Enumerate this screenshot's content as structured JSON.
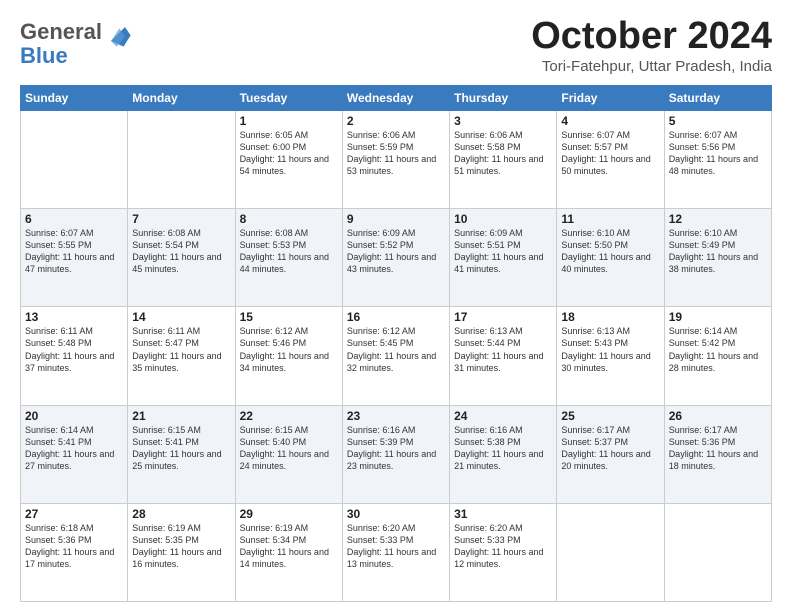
{
  "header": {
    "logo_general": "General",
    "logo_blue": "Blue",
    "month": "October 2024",
    "location": "Tori-Fatehpur, Uttar Pradesh, India"
  },
  "weekdays": [
    "Sunday",
    "Monday",
    "Tuesday",
    "Wednesday",
    "Thursday",
    "Friday",
    "Saturday"
  ],
  "weeks": [
    [
      {
        "day": "",
        "info": ""
      },
      {
        "day": "",
        "info": ""
      },
      {
        "day": "1",
        "info": "Sunrise: 6:05 AM\nSunset: 6:00 PM\nDaylight: 11 hours and 54 minutes."
      },
      {
        "day": "2",
        "info": "Sunrise: 6:06 AM\nSunset: 5:59 PM\nDaylight: 11 hours and 53 minutes."
      },
      {
        "day": "3",
        "info": "Sunrise: 6:06 AM\nSunset: 5:58 PM\nDaylight: 11 hours and 51 minutes."
      },
      {
        "day": "4",
        "info": "Sunrise: 6:07 AM\nSunset: 5:57 PM\nDaylight: 11 hours and 50 minutes."
      },
      {
        "day": "5",
        "info": "Sunrise: 6:07 AM\nSunset: 5:56 PM\nDaylight: 11 hours and 48 minutes."
      }
    ],
    [
      {
        "day": "6",
        "info": "Sunrise: 6:07 AM\nSunset: 5:55 PM\nDaylight: 11 hours and 47 minutes."
      },
      {
        "day": "7",
        "info": "Sunrise: 6:08 AM\nSunset: 5:54 PM\nDaylight: 11 hours and 45 minutes."
      },
      {
        "day": "8",
        "info": "Sunrise: 6:08 AM\nSunset: 5:53 PM\nDaylight: 11 hours and 44 minutes."
      },
      {
        "day": "9",
        "info": "Sunrise: 6:09 AM\nSunset: 5:52 PM\nDaylight: 11 hours and 43 minutes."
      },
      {
        "day": "10",
        "info": "Sunrise: 6:09 AM\nSunset: 5:51 PM\nDaylight: 11 hours and 41 minutes."
      },
      {
        "day": "11",
        "info": "Sunrise: 6:10 AM\nSunset: 5:50 PM\nDaylight: 11 hours and 40 minutes."
      },
      {
        "day": "12",
        "info": "Sunrise: 6:10 AM\nSunset: 5:49 PM\nDaylight: 11 hours and 38 minutes."
      }
    ],
    [
      {
        "day": "13",
        "info": "Sunrise: 6:11 AM\nSunset: 5:48 PM\nDaylight: 11 hours and 37 minutes."
      },
      {
        "day": "14",
        "info": "Sunrise: 6:11 AM\nSunset: 5:47 PM\nDaylight: 11 hours and 35 minutes."
      },
      {
        "day": "15",
        "info": "Sunrise: 6:12 AM\nSunset: 5:46 PM\nDaylight: 11 hours and 34 minutes."
      },
      {
        "day": "16",
        "info": "Sunrise: 6:12 AM\nSunset: 5:45 PM\nDaylight: 11 hours and 32 minutes."
      },
      {
        "day": "17",
        "info": "Sunrise: 6:13 AM\nSunset: 5:44 PM\nDaylight: 11 hours and 31 minutes."
      },
      {
        "day": "18",
        "info": "Sunrise: 6:13 AM\nSunset: 5:43 PM\nDaylight: 11 hours and 30 minutes."
      },
      {
        "day": "19",
        "info": "Sunrise: 6:14 AM\nSunset: 5:42 PM\nDaylight: 11 hours and 28 minutes."
      }
    ],
    [
      {
        "day": "20",
        "info": "Sunrise: 6:14 AM\nSunset: 5:41 PM\nDaylight: 11 hours and 27 minutes."
      },
      {
        "day": "21",
        "info": "Sunrise: 6:15 AM\nSunset: 5:41 PM\nDaylight: 11 hours and 25 minutes."
      },
      {
        "day": "22",
        "info": "Sunrise: 6:15 AM\nSunset: 5:40 PM\nDaylight: 11 hours and 24 minutes."
      },
      {
        "day": "23",
        "info": "Sunrise: 6:16 AM\nSunset: 5:39 PM\nDaylight: 11 hours and 23 minutes."
      },
      {
        "day": "24",
        "info": "Sunrise: 6:16 AM\nSunset: 5:38 PM\nDaylight: 11 hours and 21 minutes."
      },
      {
        "day": "25",
        "info": "Sunrise: 6:17 AM\nSunset: 5:37 PM\nDaylight: 11 hours and 20 minutes."
      },
      {
        "day": "26",
        "info": "Sunrise: 6:17 AM\nSunset: 5:36 PM\nDaylight: 11 hours and 18 minutes."
      }
    ],
    [
      {
        "day": "27",
        "info": "Sunrise: 6:18 AM\nSunset: 5:36 PM\nDaylight: 11 hours and 17 minutes."
      },
      {
        "day": "28",
        "info": "Sunrise: 6:19 AM\nSunset: 5:35 PM\nDaylight: 11 hours and 16 minutes."
      },
      {
        "day": "29",
        "info": "Sunrise: 6:19 AM\nSunset: 5:34 PM\nDaylight: 11 hours and 14 minutes."
      },
      {
        "day": "30",
        "info": "Sunrise: 6:20 AM\nSunset: 5:33 PM\nDaylight: 11 hours and 13 minutes."
      },
      {
        "day": "31",
        "info": "Sunrise: 6:20 AM\nSunset: 5:33 PM\nDaylight: 11 hours and 12 minutes."
      },
      {
        "day": "",
        "info": ""
      },
      {
        "day": "",
        "info": ""
      }
    ]
  ]
}
